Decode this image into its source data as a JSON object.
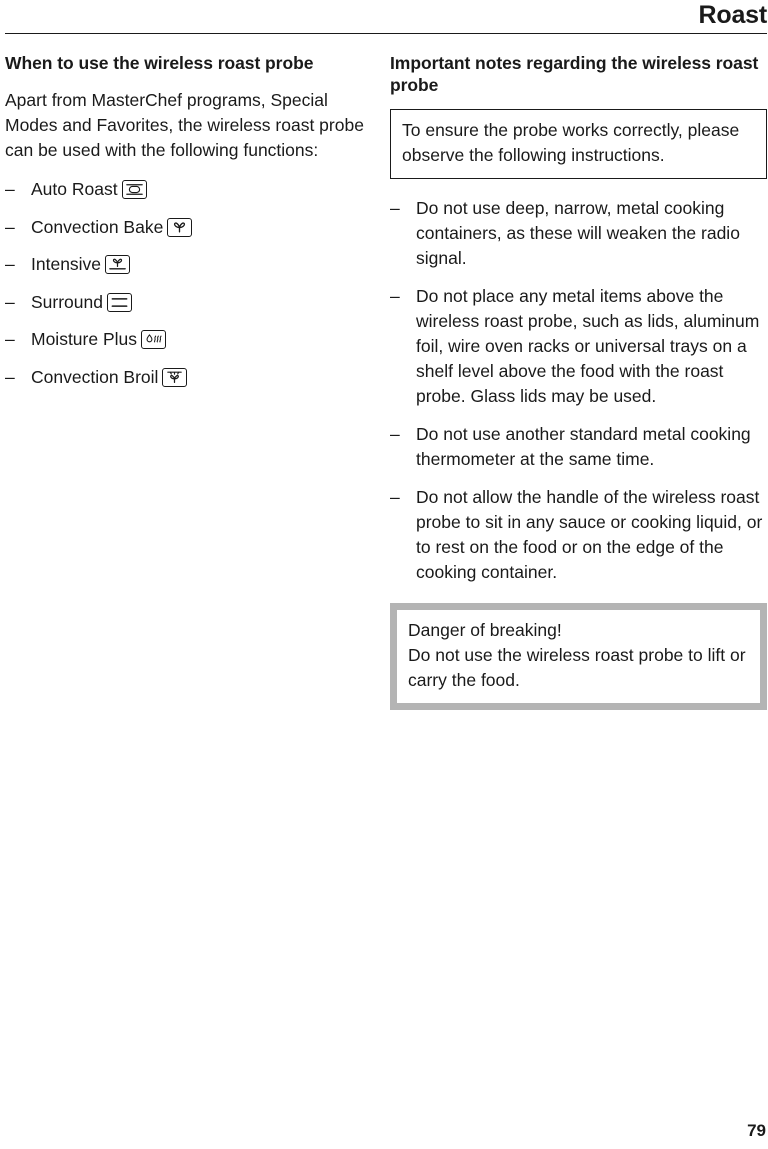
{
  "header": {
    "title": "Roast"
  },
  "left_column": {
    "heading": "When to use the wireless roast probe",
    "intro": "Apart from MasterChef programs, Special Modes and Favorites, the wireless roast probe can be used with the following functions:",
    "dash": "–",
    "functions": [
      {
        "label": "Auto Roast",
        "icon": "auto-roast-icon"
      },
      {
        "label": "Convection Bake",
        "icon": "convection-bake-fan-icon"
      },
      {
        "label": "Intensive",
        "icon": "intensive-bake-icon"
      },
      {
        "label": "Surround",
        "icon": "surround-heat-icon"
      },
      {
        "label": "Moisture Plus",
        "icon": "moisture-plus-steam-icon"
      },
      {
        "label": "Convection Broil",
        "icon": "convection-broil-icon"
      }
    ]
  },
  "right_column": {
    "heading": "Important notes regarding the wireless roast probe",
    "note_box": "To ensure the probe works correctly, please observe the following instructions.",
    "dash": "–",
    "notes": [
      "Do not use deep, narrow, metal cooking containers, as these will weaken the radio signal.",
      "Do not place any metal items above the wireless roast probe, such as lids, aluminum foil, wire oven racks or universal trays on a shelf level above the food with the roast probe. Glass lids may be used.",
      "Do not use another standard metal cooking thermometer at the same time.",
      "Do not allow the handle of the wireless roast probe to sit in any sauce or cooking liquid, or to rest on the food or on the edge of the cooking container."
    ],
    "warning_box": {
      "title": "Danger of breaking!",
      "text": "Do not use the wireless roast probe to lift or carry the food."
    }
  },
  "footer": {
    "page_number": "79"
  },
  "colors": {
    "text": "#1a1a1a",
    "rule": "#1a1a1a",
    "note_border": "#1a1a1a",
    "warning_border": "#b4b4b4",
    "background": "#ffffff"
  }
}
